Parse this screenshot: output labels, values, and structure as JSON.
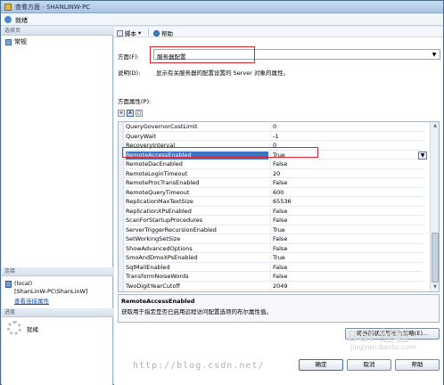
{
  "window": {
    "title": "查看方面 - SHANLINW-PC"
  },
  "status": {
    "ready": "就绪"
  },
  "left": {
    "select_page_header": "选择页",
    "pages": [
      "常规"
    ],
    "connection_header": "连接",
    "connection_lines": [
      "(local)",
      "[ShanLinW-PC\\ShanLinW]"
    ],
    "connection_link": "查看连接属性",
    "progress_header": "进度",
    "progress_text": "就绪"
  },
  "toolbar": {
    "script": "脚本",
    "help": "帮助"
  },
  "facet": {
    "label": "方面(F):",
    "value": "服务器配置",
    "description_label": "说明(D):",
    "description": "显示有关服务器的配置设置的 Server 对象的属性。",
    "properties_label": "方面属性(P):"
  },
  "properties": [
    {
      "name": "QueryGovernorCostLimit",
      "value": "0"
    },
    {
      "name": "QueryWait",
      "value": "-1"
    },
    {
      "name": "RecoveryInterval",
      "value": "0"
    },
    {
      "name": "RemoteAccessEnabled",
      "value": "True"
    },
    {
      "name": "RemoteDacEnabled",
      "value": "False"
    },
    {
      "name": "RemoteLoginTimeout",
      "value": "20"
    },
    {
      "name": "RemoteProcTransEnabled",
      "value": "False"
    },
    {
      "name": "RemoteQueryTimeout",
      "value": "600"
    },
    {
      "name": "ReplicationMaxTextSize",
      "value": "65536"
    },
    {
      "name": "ReplicationXPsEnabled",
      "value": "False"
    },
    {
      "name": "ScanForStartupProcedures",
      "value": "False"
    },
    {
      "name": "ServerTriggerRecursionEnabled",
      "value": "True"
    },
    {
      "name": "SetWorkingSetSize",
      "value": "False"
    },
    {
      "name": "ShowAdvancedOptions",
      "value": "False"
    },
    {
      "name": "SmoAndDmoXPsEnabled",
      "value": "True"
    },
    {
      "name": "SqlMailEnabled",
      "value": "False"
    },
    {
      "name": "TransformNoiseWords",
      "value": "False"
    },
    {
      "name": "TwoDigitYearCutoff",
      "value": "2049"
    }
  ],
  "selected_property": {
    "title": "RemoteAccessEnabled",
    "description": "获取用于指定是否已启用远程访问配置选项的布尔属性值。"
  },
  "buttons": {
    "export": "将当前状态导出为策略(E)...",
    "ok": "确定",
    "cancel": "取消",
    "help": "帮助"
  },
  "watermark": {
    "url": "http://blog.csdn.net/",
    "logo": "Bai 经验",
    "logo_sub": "jingyan.baidu.com"
  },
  "colors": {
    "highlight_box": "#d9242c",
    "selection": "#3d72c4"
  }
}
